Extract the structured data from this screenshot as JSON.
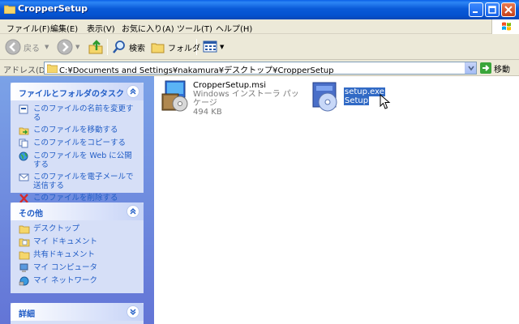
{
  "window": {
    "title": "CropperSetup"
  },
  "menu": [
    "ファイル(F)",
    "編集(E)",
    "表示(V)",
    "お気に入り(A)",
    "ツール(T)",
    "ヘルプ(H)"
  ],
  "toolbar": {
    "back": "戻る",
    "search": "検索",
    "folders": "フォルダ"
  },
  "address": {
    "label": "アドレス(D)",
    "path": "C:¥Documents and Settings¥nakamura¥デスクトップ¥CropperSetup",
    "go": "移動"
  },
  "tasks": {
    "title": "ファイルとフォルダのタスク",
    "items": [
      "このファイルの名前を変更する",
      "このファイルを移動する",
      "このファイルをコピーする",
      "このファイルを Web に公開する",
      "このファイルを電子メールで送信する",
      "このファイルを削除する"
    ]
  },
  "places": {
    "title": "その他",
    "items": [
      "デスクトップ",
      "マイ ドキュメント",
      "共有ドキュメント",
      "マイ コンピュータ",
      "マイ ネットワーク"
    ]
  },
  "details": {
    "title": "詳細"
  },
  "files": [
    {
      "name": "CropperSetup.msi",
      "type": "Windows インストーラ パッケージ",
      "size": "494 KB"
    },
    {
      "name": "setup.exe",
      "type": "Setup"
    }
  ],
  "colors": {
    "titlebar": "#0a5ad8",
    "link": "#215dc6",
    "selection": "#316ac5"
  }
}
